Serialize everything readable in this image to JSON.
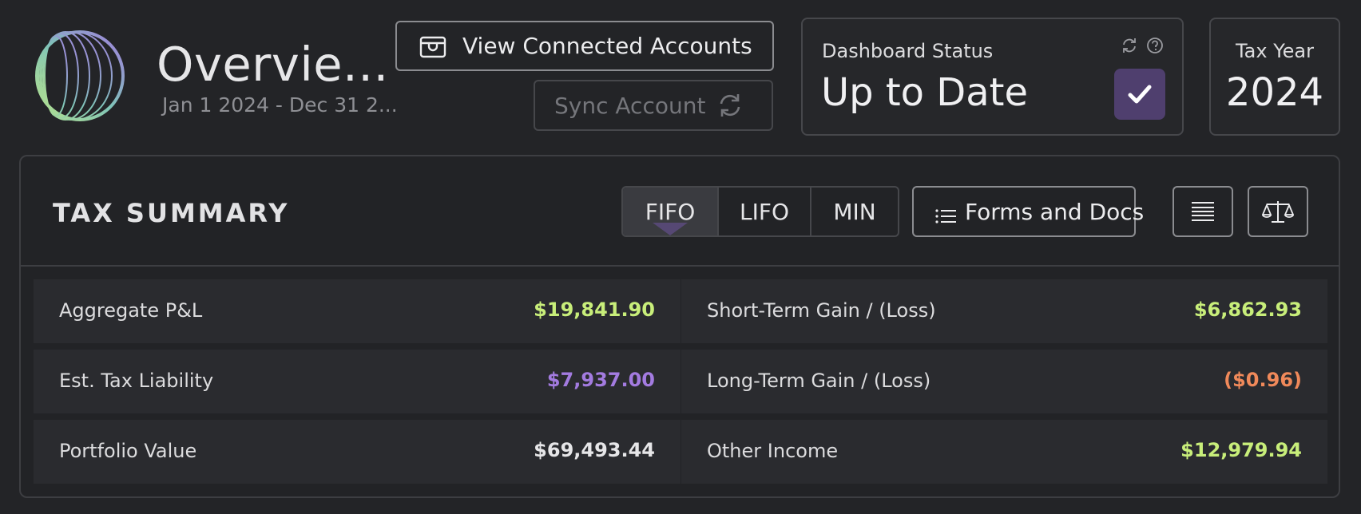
{
  "header": {
    "title": "Overvie...",
    "date_range": "Jan 1 2024 - Dec 31 2...",
    "view_accounts_label": "View Connected Accounts",
    "sync_label": "Sync Account"
  },
  "status": {
    "label": "Dashboard Status",
    "value": "Up to Date"
  },
  "tax_year": {
    "label": "Tax Year",
    "value": "2024"
  },
  "summary": {
    "title": "TAX SUMMARY",
    "methods": [
      "FIFO",
      "LIFO",
      "MIN"
    ],
    "active_method": "FIFO",
    "forms_label": "Forms and Docs",
    "rows": [
      {
        "left_label": "Aggregate P&L",
        "left_value": "$19,841.90",
        "left_color": "#c8ee7a",
        "right_label": "Short-Term Gain / (Loss)",
        "right_value": "$6,862.93",
        "right_color": "#c8ee7a"
      },
      {
        "left_label": "Est. Tax Liability",
        "left_value": "$7,937.00",
        "left_color": "#a37be0",
        "right_label": "Long-Term Gain / (Loss)",
        "right_value": "($0.96)",
        "right_color": "#f0895a"
      },
      {
        "left_label": "Portfolio Value",
        "left_value": "$69,493.44",
        "left_color": "#e6e6e8",
        "right_label": "Other Income",
        "right_value": "$12,979.94",
        "right_color": "#c8ee7a"
      }
    ]
  },
  "icons": {
    "logo": "ring-logo",
    "view_accounts": "wallet-icon",
    "sync": "refresh-icon",
    "status_refresh": "refresh-icon",
    "status_help": "help-circle-icon",
    "status_check": "check-icon",
    "forms": "list-icon",
    "ledger": "rows-icon",
    "compare": "scale-icon"
  }
}
